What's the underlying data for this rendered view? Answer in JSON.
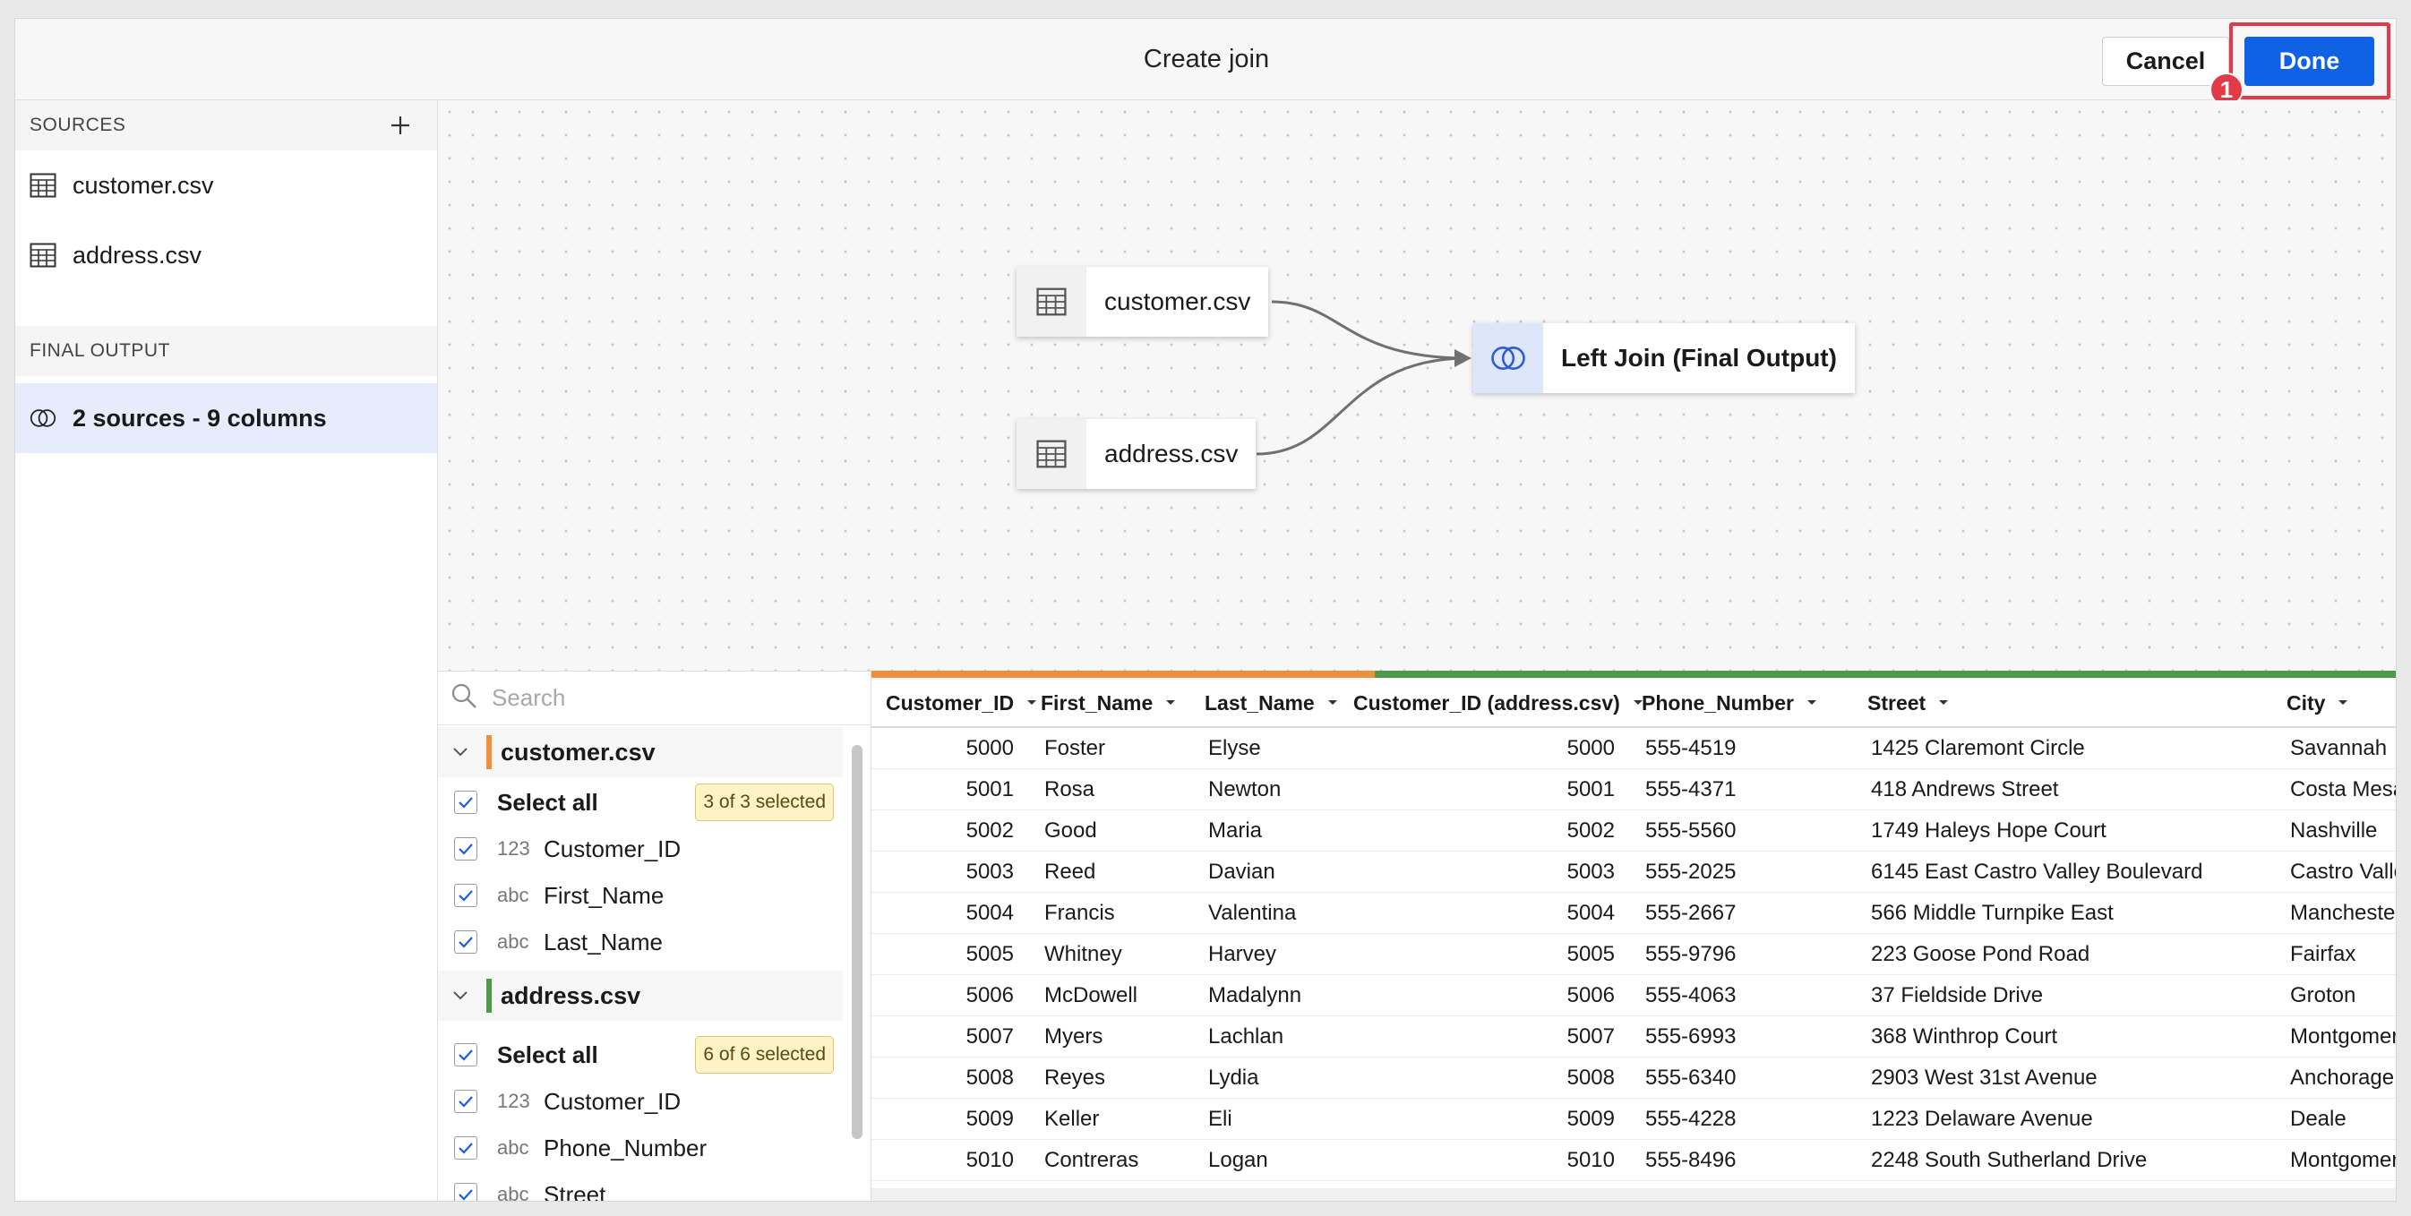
{
  "header": {
    "title": "Create join",
    "cancel_label": "Cancel",
    "done_label": "Done",
    "step_badge": "1"
  },
  "sidebar": {
    "sources_heading": "SOURCES",
    "sources": [
      {
        "label": "customer.csv",
        "icon": "table-icon"
      },
      {
        "label": "address.csv",
        "icon": "table-icon"
      }
    ],
    "final_output_heading": "FINAL OUTPUT",
    "final_output": {
      "label": "2 sources - 9 columns",
      "icon": "join-icon"
    }
  },
  "canvas": {
    "nodes": [
      {
        "label": "customer.csv",
        "icon": "table-icon"
      },
      {
        "label": "address.csv",
        "icon": "table-icon"
      },
      {
        "label": "Left Join (Final Output)",
        "icon": "join-icon"
      }
    ]
  },
  "picker": {
    "search_placeholder": "Search",
    "groups": [
      {
        "name": "customer.csv",
        "color": "#f08f3a",
        "select_all_label": "Select all",
        "selected_badge": "3 of 3 selected",
        "columns": [
          {
            "type": "123",
            "name": "Customer_ID"
          },
          {
            "type": "abc",
            "name": "First_Name"
          },
          {
            "type": "abc",
            "name": "Last_Name"
          }
        ]
      },
      {
        "name": "address.csv",
        "color": "#4e9a49",
        "select_all_label": "Select all",
        "selected_badge": "6 of 6 selected",
        "columns": [
          {
            "type": "123",
            "name": "Customer_ID"
          },
          {
            "type": "abc",
            "name": "Phone_Number"
          },
          {
            "type": "abc",
            "name": "Street"
          }
        ]
      }
    ]
  },
  "table": {
    "columns": [
      "Customer_ID",
      "First_Name",
      "Last_Name",
      "Customer_ID (address.csv)",
      "Phone_Number",
      "Street",
      "City"
    ],
    "rows": [
      [
        "5000",
        "Foster",
        "Elyse",
        "5000",
        "555-4519",
        "1425 Claremont Circle",
        "Savannah"
      ],
      [
        "5001",
        "Rosa",
        "Newton",
        "5001",
        "555-4371",
        "418 Andrews Street",
        "Costa Mesa"
      ],
      [
        "5002",
        "Good",
        "Maria",
        "5002",
        "555-5560",
        "1749 Haleys Hope Court",
        "Nashville"
      ],
      [
        "5003",
        "Reed",
        "Davian",
        "5003",
        "555-2025",
        "6145 East Castro Valley Boulevard",
        "Castro Valley"
      ],
      [
        "5004",
        "Francis",
        "Valentina",
        "5004",
        "555-2667",
        "566 Middle Turnpike East",
        "Manchester"
      ],
      [
        "5005",
        "Whitney",
        "Harvey",
        "5005",
        "555-9796",
        "223 Goose Pond Road",
        "Fairfax"
      ],
      [
        "5006",
        "McDowell",
        "Madalynn",
        "5006",
        "555-4063",
        "37 Fieldside Drive",
        "Groton"
      ],
      [
        "5007",
        "Myers",
        "Lachlan",
        "5007",
        "555-6993",
        "368 Winthrop Court",
        "Montgomery"
      ],
      [
        "5008",
        "Reyes",
        "Lydia",
        "5008",
        "555-6340",
        "2903 West 31st Avenue",
        "Anchorage"
      ],
      [
        "5009",
        "Keller",
        "Eli",
        "5009",
        "555-4228",
        "1223 Delaware Avenue",
        "Deale"
      ],
      [
        "5010",
        "Contreras",
        "Logan",
        "5010",
        "555-8496",
        "2248 South Sutherland Drive",
        "Montgomery"
      ]
    ]
  },
  "colors": {
    "accent": "#0f62e4",
    "highlight": "#e23b47",
    "customer_source": "#f08f3a",
    "address_source": "#4e9a49"
  }
}
